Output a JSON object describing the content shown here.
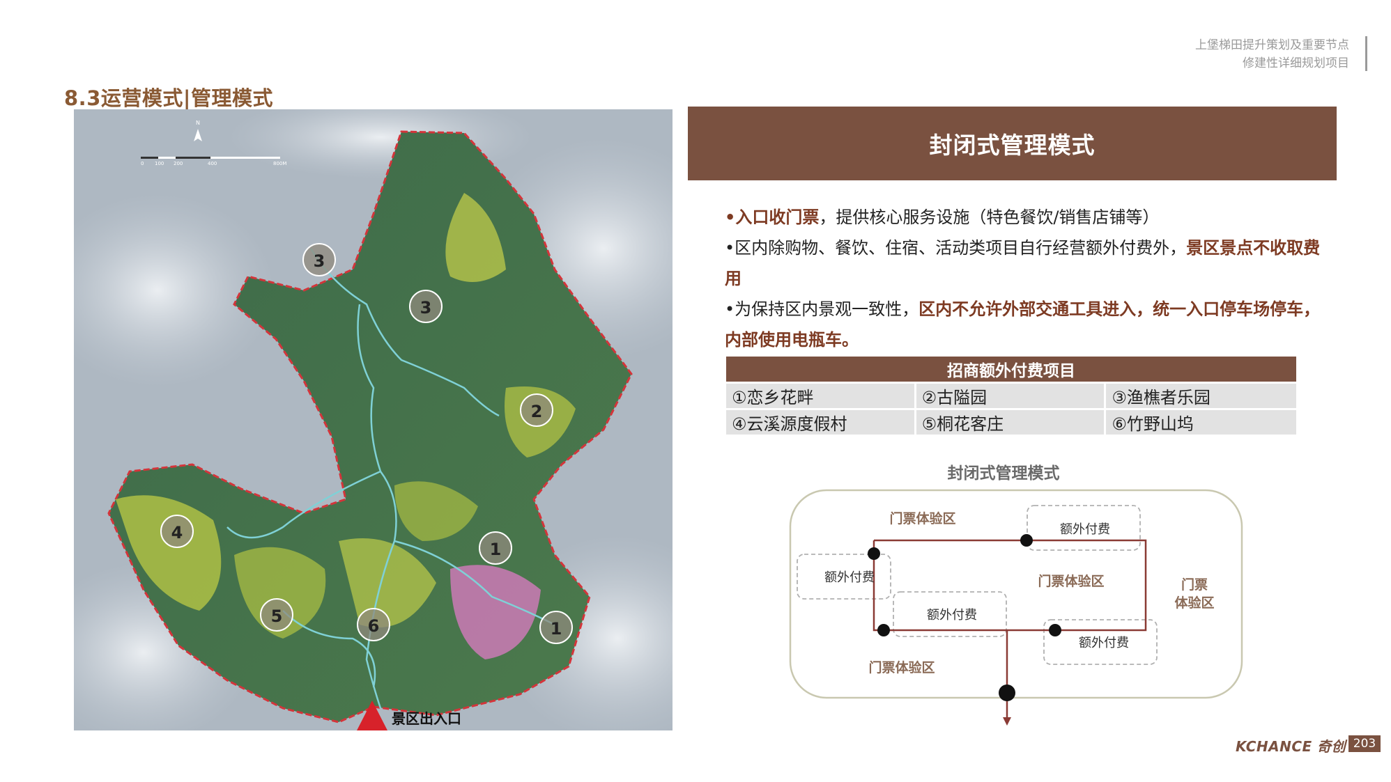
{
  "header": {
    "project_line1": "上堡梯田提升策划及重要节点",
    "project_line2": "修建性详细规划项目"
  },
  "section_title": "8.3运营模式|管理模式",
  "map": {
    "compass_label": "N",
    "scale_labels": [
      "0",
      "100",
      "200",
      "400",
      "800M"
    ],
    "markers": [
      "3",
      "3",
      "2",
      "4",
      "1",
      "5",
      "6",
      "1"
    ],
    "entrance_label": "景区出入口"
  },
  "banner_title": "封闭式管理模式",
  "bullets": {
    "b1_hl": "•入口收门票",
    "b1_rest": "，提供核心服务设施（特色餐饮/销售店铺等）",
    "b2_plain": "•区内除购物、餐饮、住宿、活动类项目自行经营额外付费外，",
    "b2_hl": "景区景点不收取费用",
    "b3_plain": "•为保持区内景观一致性，",
    "b3_hl": "区内不允许外部交通工具进入，统一入口停车场停车，内部使用电瓶车。"
  },
  "table": {
    "header": "招商额外付费项目",
    "rows": [
      [
        "①恋乡花畔",
        "②古隘园",
        "③渔樵者乐园"
      ],
      [
        "④云溪源度假村",
        "⑤桐花客庄",
        "⑥竹野山坞"
      ]
    ]
  },
  "diagram": {
    "title": "封闭式管理模式",
    "zone_top": "门票体验区",
    "zone_center": "门票体验区",
    "zone_bottom": "门票体验区",
    "zone_right_line1": "门票",
    "zone_right_line2": "体验区",
    "pay_top_right": "额外付费",
    "pay_left": "额外付费",
    "pay_center": "额外付费",
    "pay_bottom_right": "额外付费"
  },
  "footer": {
    "brand": "KCHANCE 奇创",
    "page_number": "203"
  },
  "colors": {
    "brand_brown": "#7a5140",
    "title_brown": "#8a5a34",
    "highlight": "#7d3a22",
    "table_cell": "#e2e2e2"
  }
}
